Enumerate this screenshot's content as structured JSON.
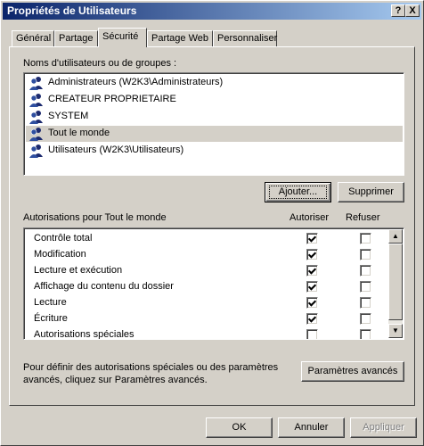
{
  "window": {
    "title": "Propriétés de Utilisateurs",
    "help_btn": "?",
    "close_btn": "X"
  },
  "tabs": [
    {
      "label": "Général"
    },
    {
      "label": "Partage"
    },
    {
      "label": "Sécurité"
    },
    {
      "label": "Partage Web"
    },
    {
      "label": "Personnaliser"
    }
  ],
  "users": {
    "label": "Noms d'utilisateurs ou de groupes :",
    "items": [
      {
        "label": "Administrateurs (W2K3\\Administrateurs)"
      },
      {
        "label": "CREATEUR PROPRIETAIRE"
      },
      {
        "label": "SYSTEM"
      },
      {
        "label": "Tout le monde"
      },
      {
        "label": "Utilisateurs (W2K3\\Utilisateurs)"
      }
    ],
    "selected_index": 3
  },
  "buttons": {
    "add": "Ajouter...",
    "remove": "Supprimer",
    "advanced": "Paramètres avancés",
    "ok": "OK",
    "cancel": "Annuler",
    "apply": "Appliquer"
  },
  "permissions": {
    "label": "Autorisations pour Tout le monde",
    "col_allow": "Autoriser",
    "col_deny": "Refuser",
    "rows": [
      {
        "label": "Contrôle total",
        "allow": true,
        "deny": false
      },
      {
        "label": "Modification",
        "allow": true,
        "deny": false
      },
      {
        "label": "Lecture et exécution",
        "allow": true,
        "deny": false
      },
      {
        "label": "Affichage du contenu du dossier",
        "allow": true,
        "deny": false
      },
      {
        "label": "Lecture",
        "allow": true,
        "deny": false
      },
      {
        "label": "Écriture",
        "allow": true,
        "deny": false
      },
      {
        "label": "Autorisations spéciales",
        "allow": false,
        "deny": false
      }
    ]
  },
  "info": {
    "line1": "Pour définir des autorisations spéciales ou des paramètres",
    "line2": "avancés, cliquez sur Paramètres avancés."
  },
  "icons": {
    "user": "users-group-icon",
    "scroll_up": "arrow-up-icon",
    "scroll_down": "arrow-down-icon"
  }
}
